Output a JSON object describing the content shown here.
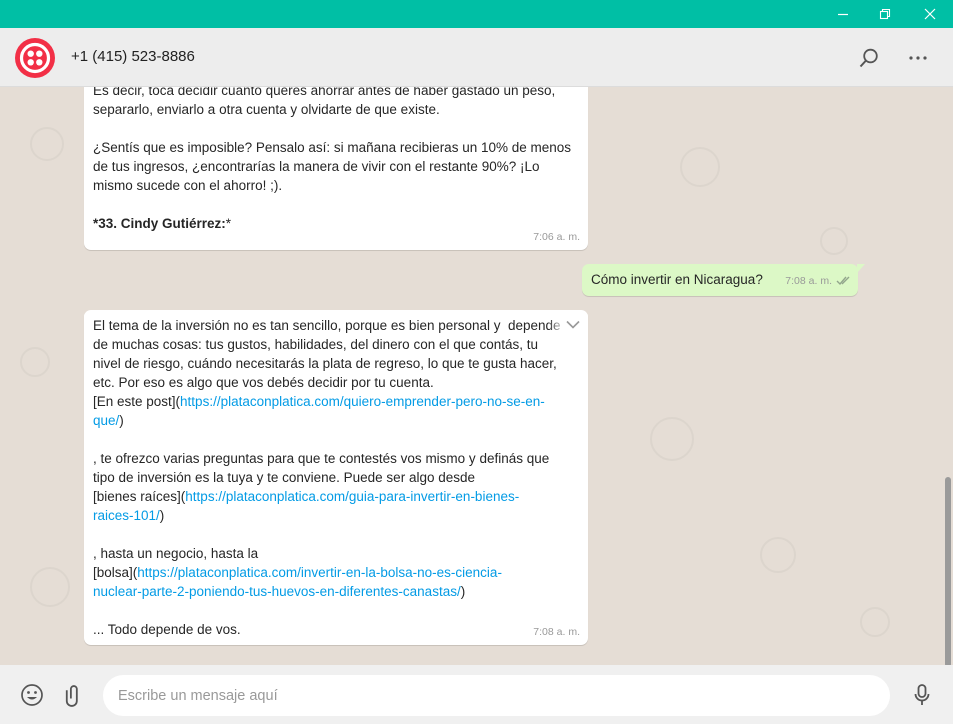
{
  "window": {
    "controls": [
      "minimize-icon",
      "restore-icon",
      "close-icon"
    ],
    "accent": "#00bfa5"
  },
  "header": {
    "contact": "+1 (415) 523-8886",
    "avatar_icon": "twilio-logo-icon",
    "avatar_color": "#f22f46",
    "icons": [
      "search-icon",
      "menu-dots-icon"
    ]
  },
  "messages": [
    {
      "direction": "in",
      "lines": [
        "Es decir, toca decidir cuánto querés ahorrar antes de haber gastado un peso,",
        "separarlo, enviarlo a otra cuenta y olvidarte de que existe.",
        "",
        "¿Sentís que es imposible? Pensalo así: si mañana recibieras un 10% de menos",
        "de tus ingresos, ¿encontrarías la manera de vivir con el restante 90%? ¡Lo",
        "mismo sucede con el ahorro! ;).",
        ""
      ],
      "bold_line": "*33. Cindy Gutiérrez:",
      "bold_suffix": "*",
      "time": "7:06 a. m."
    },
    {
      "direction": "out",
      "text": "Cómo invertir en Nicaragua?",
      "time": "7:08 a. m.",
      "status_icon": "double-check-icon"
    },
    {
      "direction": "in",
      "p1": "El tema de la inversión no es tan sencillo, porque es bien personal y  depende\nde muchas cosas: tus gustos, habilidades, del dinero con el que contás, tu\nnivel de riesgo, cuándo necesitarás la plata de regreso, lo que te gusta hacer,\netc. Por eso es algo que vos debés decidir por tu cuenta.\n[En este post](",
      "link1": "https://plataconplatica.com/quiero-emprender-pero-no-se-en-\nque/",
      "p2": ")\n\n, te ofrezco varias preguntas para que te contestés vos mismo y definás que\ntipo de inversión es la tuya y te conviene. Puede ser algo desde\n[bienes raíces](",
      "link2": "https://plataconplatica.com/guia-para-invertir-en-bienes-\nraices-101/",
      "p3": ")\n\n, hasta un negocio, hasta la\n[bolsa](",
      "link3": "https://plataconplatica.com/invertir-en-la-bolsa-no-es-ciencia-\nnuclear-parte-2-poniendo-tus-huevos-en-diferentes-canastas/",
      "p4": ")\n\n... Todo depende de vos.",
      "time": "7:08 a. m.",
      "menu_icon": "chevron-down-icon"
    }
  ],
  "footer": {
    "placeholder": "Escribe un mensaje aquí",
    "icons": [
      "emoji-icon",
      "attach-icon",
      "microphone-icon"
    ]
  }
}
